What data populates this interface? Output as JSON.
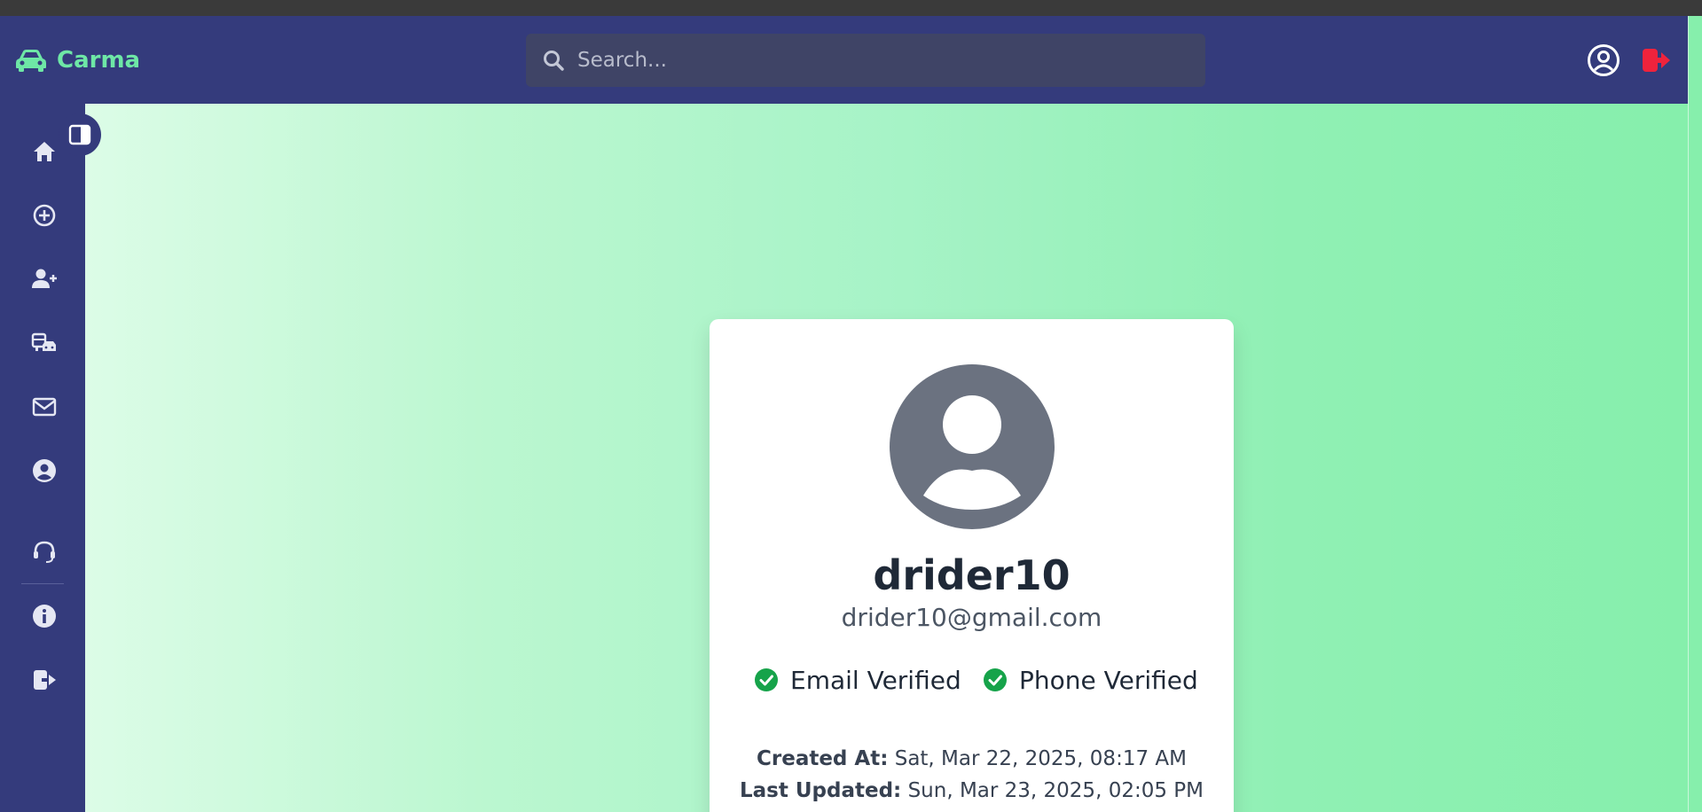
{
  "brand": {
    "name": "Carma",
    "color": "#6ee7a6"
  },
  "search": {
    "placeholder": "Search..."
  },
  "navbar": {
    "user_icon": "user-circle-icon",
    "logout_icon": "logout-icon",
    "logout_color": "#ef233c"
  },
  "sidebar": {
    "items": [
      {
        "icon": "home-icon"
      },
      {
        "icon": "plus-circle-icon"
      },
      {
        "icon": "user-plus-icon"
      },
      {
        "icon": "vehicles-icon"
      },
      {
        "icon": "envelope-icon"
      },
      {
        "icon": "user-circle-icon"
      },
      {
        "icon": "headset-icon"
      },
      {
        "icon": "info-icon"
      },
      {
        "icon": "sign-out-icon"
      }
    ],
    "toggle_icon": "sidebar-toggle-icon"
  },
  "profile": {
    "username": "drider10",
    "email": "drider10@gmail.com",
    "email_verified_label": "Email Verified",
    "phone_verified_label": "Phone Verified",
    "created_label": "Created At:",
    "created_value": "Sat, Mar 22, 2025, 08:17 AM",
    "updated_label": "Last Updated:",
    "updated_value": "Sun, Mar 23, 2025, 02:05 PM",
    "check_color": "#16a34a"
  }
}
